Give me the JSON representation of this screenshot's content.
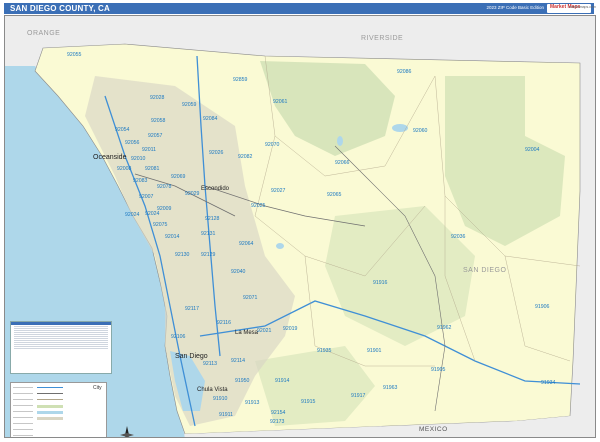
{
  "title": "SAN DIEGO COUNTY, CA",
  "subtitle": "2023 ZIP Code Basic Edition",
  "logo": {
    "main": "Market Maps",
    "sub": "marketmaps.com"
  },
  "colors": {
    "title_bar": "#3b6fb6",
    "land": "#fafad4",
    "water": "#aed7ea",
    "neighbor": "#ededed",
    "public_land": "#cfe0b4",
    "urban": "#d9d6c4",
    "zip_label": "#1a78c2",
    "freeway": "#3f8fd6"
  },
  "regions": {
    "orange": "ORANGE",
    "riverside": "RIVERSIDE",
    "san_diego": "SAN DIEGO",
    "mexico": "MEXICO"
  },
  "cities": {
    "oceanside": "Oceanside",
    "escondido": "Escondido",
    "la_mesa": "La Mesa",
    "san_diego": "San Diego",
    "chula_vista": "Chula Vista"
  },
  "zip_labels": [
    "92055",
    "92859",
    "92028",
    "92086",
    "92061",
    "92060",
    "92070",
    "92066",
    "92036",
    "92065",
    "92004",
    "92025",
    "92027",
    "92029",
    "92064",
    "92131",
    "92040",
    "92071",
    "91916",
    "92021",
    "92019",
    "91935",
    "91901",
    "91962",
    "91905",
    "91963",
    "91917",
    "91934",
    "92154",
    "92173",
    "92114",
    "92113",
    "92116",
    "92117",
    "92106",
    "92130",
    "92014",
    "92024",
    "92007",
    "92075",
    "92129",
    "92128",
    "92082",
    "92026",
    "92058",
    "92054",
    "92056",
    "92057",
    "92081",
    "92083",
    "92069",
    "92078",
    "91906",
    "92059",
    "91950",
    "91910",
    "91911",
    "91913",
    "91914",
    "91915",
    "92024",
    "92009",
    "92010",
    "92011",
    "92008",
    "92084"
  ],
  "legend": {
    "zip_table_header": "ZIP Code Index",
    "city_heading": "City"
  }
}
